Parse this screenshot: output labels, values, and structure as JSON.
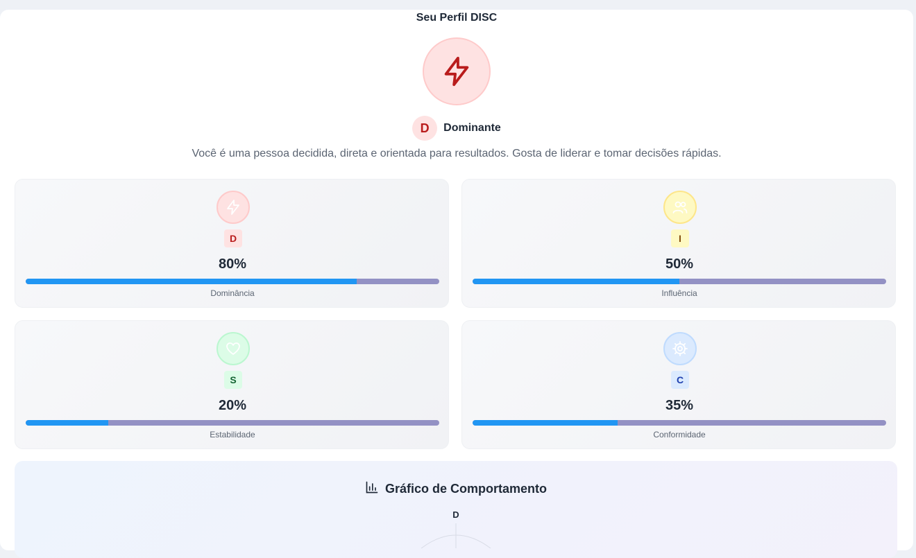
{
  "page": {
    "title": "Seu Perfil DISC"
  },
  "profile": {
    "icon": "lightning-icon",
    "letter": "D",
    "name": "Dominante",
    "description": "Você é uma pessoa decidida, direta e orientada para resultados. Gosta de liderar e tomar decisões rápidas."
  },
  "dimensions": [
    {
      "letter": "D",
      "percent_label": "80%",
      "percent": 80,
      "label": "Dominância",
      "icon": "lightning-icon",
      "color": "#ef4444",
      "bg": "#fee2e2",
      "letter_color": "#b91c1c"
    },
    {
      "letter": "I",
      "percent_label": "50%",
      "percent": 50,
      "label": "Influência",
      "icon": "users-icon",
      "color": "#eab308",
      "bg": "#fef9c3",
      "letter_color": "#854d0e"
    },
    {
      "letter": "S",
      "percent_label": "20%",
      "percent": 20,
      "label": "Estabilidade",
      "icon": "heart-icon",
      "color": "#22c55e",
      "bg": "#dcfce7",
      "letter_color": "#166534"
    },
    {
      "letter": "C",
      "percent_label": "35%",
      "percent": 35,
      "label": "Conformidade",
      "icon": "gear-icon",
      "color": "#3b82f6",
      "bg": "#dbeafe",
      "letter_color": "#1e40af"
    }
  ],
  "bar_colors": {
    "fill": "#2196f3",
    "track": "#9391c4"
  },
  "behavior_chart": {
    "title": "Gráfico de Comportamento",
    "icon": "bar-chart-icon",
    "axis_top": "D"
  }
}
